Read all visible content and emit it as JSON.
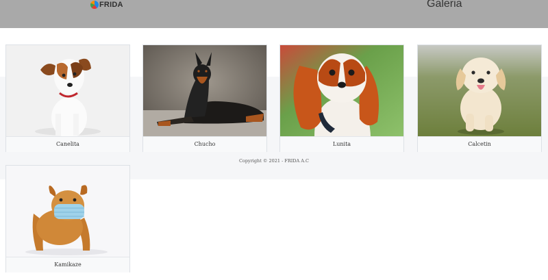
{
  "header": {
    "logo_text": "FRIDA",
    "logo_icon": "frida-logo-icon",
    "title": "Galeria"
  },
  "gallery": [
    {
      "caption": "Canelita",
      "icon": "dog-photo-jack-russell"
    },
    {
      "caption": "Chucho",
      "icon": "dog-photo-doberman"
    },
    {
      "caption": "Lunita",
      "icon": "dog-photo-cavalier"
    },
    {
      "caption": "Calcetin",
      "icon": "dog-photo-golden-puppy"
    },
    {
      "caption": "Kamikaze",
      "icon": "dog-photo-bulldog-mask"
    }
  ],
  "footer": {
    "copyright": "Copyright © 2021 - FRIDA A.C"
  },
  "colors": {
    "header_bg": "#a9a9a9",
    "band_bg": "#f5f6f8"
  }
}
